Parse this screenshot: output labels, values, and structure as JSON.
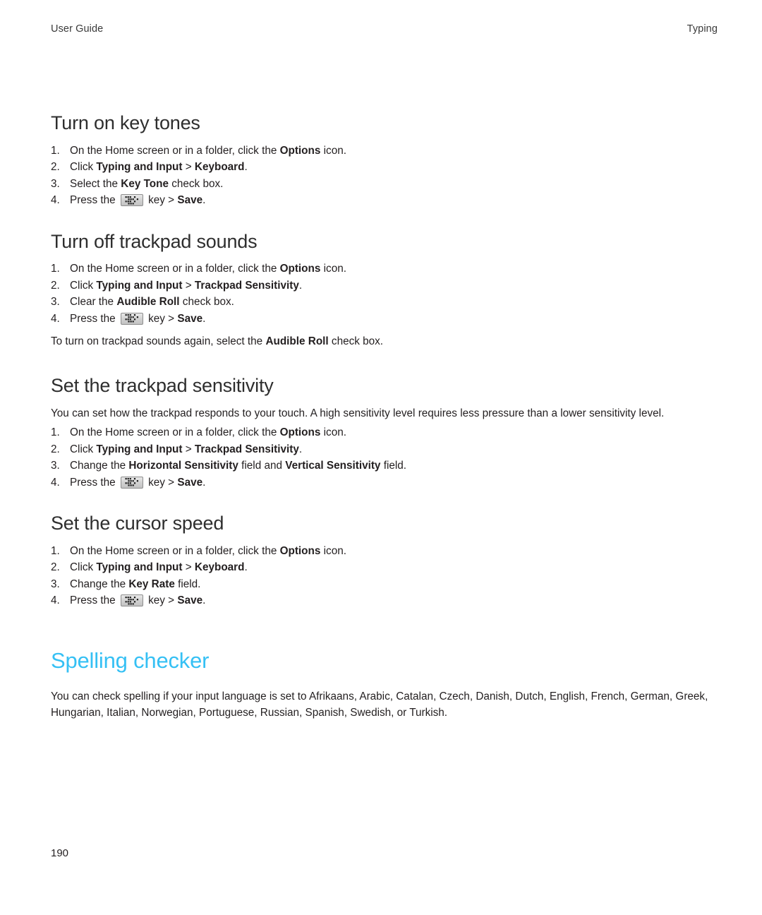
{
  "header": {
    "left": "User Guide",
    "right": "Typing"
  },
  "colors": {
    "chapter_heading": "#35c0f4",
    "section_heading": "#2e2e2e",
    "body_text": "#231f20"
  },
  "icons": {
    "menu_key": "blackberry-menu-key-icon"
  },
  "sections": [
    {
      "title": "Turn on key tones",
      "steps": [
        {
          "num": "1.",
          "parts": [
            {
              "t": "On the Home screen or in a folder, click the ",
              "b": false
            },
            {
              "t": "Options",
              "b": true
            },
            {
              "t": " icon.",
              "b": false
            }
          ]
        },
        {
          "num": "2.",
          "parts": [
            {
              "t": "Click ",
              "b": false
            },
            {
              "t": "Typing and Input",
              "b": true
            },
            {
              "t": " > ",
              "b": false
            },
            {
              "t": "Keyboard",
              "b": true
            },
            {
              "t": ".",
              "b": false
            }
          ]
        },
        {
          "num": "3.",
          "parts": [
            {
              "t": "Select the ",
              "b": false
            },
            {
              "t": "Key Tone",
              "b": true
            },
            {
              "t": " check box.",
              "b": false
            }
          ]
        },
        {
          "num": "4.",
          "icon": "menu_key",
          "parts": [
            {
              "t": "Press the ",
              "b": false
            },
            {
              "icon": true
            },
            {
              "t": " key > ",
              "b": false
            },
            {
              "t": "Save",
              "b": true
            },
            {
              "t": ".",
              "b": false
            }
          ]
        }
      ]
    },
    {
      "title": "Turn off trackpad sounds",
      "steps": [
        {
          "num": "1.",
          "parts": [
            {
              "t": "On the Home screen or in a folder, click the ",
              "b": false
            },
            {
              "t": "Options",
              "b": true
            },
            {
              "t": " icon.",
              "b": false
            }
          ]
        },
        {
          "num": "2.",
          "parts": [
            {
              "t": "Click ",
              "b": false
            },
            {
              "t": "Typing and Input",
              "b": true
            },
            {
              "t": " > ",
              "b": false
            },
            {
              "t": "Trackpad Sensitivity",
              "b": true
            },
            {
              "t": ".",
              "b": false
            }
          ]
        },
        {
          "num": "3.",
          "parts": [
            {
              "t": "Clear the ",
              "b": false
            },
            {
              "t": "Audible Roll",
              "b": true
            },
            {
              "t": " check box.",
              "b": false
            }
          ]
        },
        {
          "num": "4.",
          "parts": [
            {
              "t": "Press the ",
              "b": false
            },
            {
              "icon": true
            },
            {
              "t": " key > ",
              "b": false
            },
            {
              "t": "Save",
              "b": true
            },
            {
              "t": ".",
              "b": false
            }
          ]
        }
      ],
      "after_note": [
        {
          "t": "To turn on trackpad sounds again, select the ",
          "b": false
        },
        {
          "t": "Audible Roll",
          "b": true
        },
        {
          "t": " check box.",
          "b": false
        }
      ]
    },
    {
      "title": "Set the trackpad sensitivity",
      "intro": [
        {
          "t": "You can set how the trackpad responds to your touch. A high sensitivity level requires less pressure than a lower sensitivity level.",
          "b": false
        }
      ],
      "steps": [
        {
          "num": "1.",
          "parts": [
            {
              "t": "On the Home screen or in a folder, click the ",
              "b": false
            },
            {
              "t": "Options",
              "b": true
            },
            {
              "t": " icon.",
              "b": false
            }
          ]
        },
        {
          "num": "2.",
          "parts": [
            {
              "t": "Click ",
              "b": false
            },
            {
              "t": "Typing and Input",
              "b": true
            },
            {
              "t": " > ",
              "b": false
            },
            {
              "t": "Trackpad Sensitivity",
              "b": true
            },
            {
              "t": ".",
              "b": false
            }
          ]
        },
        {
          "num": "3.",
          "parts": [
            {
              "t": "Change the ",
              "b": false
            },
            {
              "t": "Horizontal Sensitivity",
              "b": true
            },
            {
              "t": " field and ",
              "b": false
            },
            {
              "t": "Vertical Sensitivity",
              "b": true
            },
            {
              "t": " field.",
              "b": false
            }
          ]
        },
        {
          "num": "4.",
          "parts": [
            {
              "t": "Press the ",
              "b": false
            },
            {
              "icon": true
            },
            {
              "t": " key > ",
              "b": false
            },
            {
              "t": "Save",
              "b": true
            },
            {
              "t": ".",
              "b": false
            }
          ]
        }
      ]
    },
    {
      "title": "Set the cursor speed",
      "steps": [
        {
          "num": "1.",
          "parts": [
            {
              "t": "On the Home screen or in a folder, click the ",
              "b": false
            },
            {
              "t": "Options",
              "b": true
            },
            {
              "t": " icon.",
              "b": false
            }
          ]
        },
        {
          "num": "2.",
          "parts": [
            {
              "t": "Click ",
              "b": false
            },
            {
              "t": "Typing and Input",
              "b": true
            },
            {
              "t": " > ",
              "b": false
            },
            {
              "t": "Keyboard",
              "b": true
            },
            {
              "t": ".",
              "b": false
            }
          ]
        },
        {
          "num": "3.",
          "parts": [
            {
              "t": "Change the ",
              "b": false
            },
            {
              "t": "Key Rate",
              "b": true
            },
            {
              "t": " field.",
              "b": false
            }
          ]
        },
        {
          "num": "4.",
          "parts": [
            {
              "t": "Press the ",
              "b": false
            },
            {
              "icon": true
            },
            {
              "t": " key > ",
              "b": false
            },
            {
              "t": "Save",
              "b": true
            },
            {
              "t": ".",
              "b": false
            }
          ]
        }
      ]
    }
  ],
  "chapter": {
    "title": "Spelling checker",
    "paragraph": "You can check spelling if your input language is set to Afrikaans, Arabic, Catalan, Czech, Danish, Dutch, English, French, German, Greek, Hungarian, Italian, Norwegian, Portuguese, Russian, Spanish, Swedish, or Turkish."
  },
  "folio": "190"
}
